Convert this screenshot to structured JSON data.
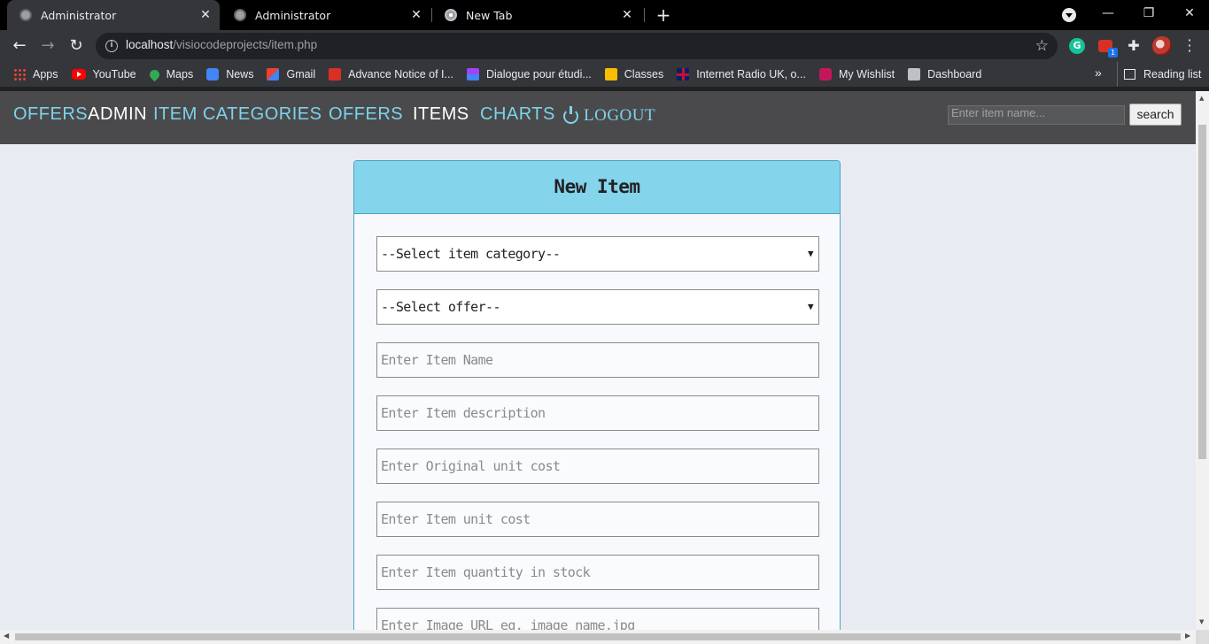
{
  "browser": {
    "tabs": [
      {
        "label": "Administrator",
        "active": true
      },
      {
        "label": "Administrator",
        "active": false
      },
      {
        "label": "New Tab",
        "active": false
      }
    ],
    "url_host": "localhost",
    "url_path": "/visiocodeprojects/item.php",
    "extension_badge": "1",
    "bookmarks": [
      {
        "label": "Apps",
        "icon": "apps-grid-icon"
      },
      {
        "label": "YouTube",
        "icon": "youtube-icon"
      },
      {
        "label": "Maps",
        "icon": "maps-pin-icon"
      },
      {
        "label": "News",
        "icon": "news-icon"
      },
      {
        "label": "Gmail",
        "icon": "gmail-icon"
      },
      {
        "label": "Advance Notice of I...",
        "icon": "mail-icon"
      },
      {
        "label": "Dialogue pour étudi...",
        "icon": "grid-icon"
      },
      {
        "label": "Classes",
        "icon": "classes-icon"
      },
      {
        "label": "Internet Radio UK, o...",
        "icon": "uk-flag-icon"
      },
      {
        "label": "My Wishlist",
        "icon": "wishlist-icon"
      },
      {
        "label": "Dashboard",
        "icon": "dashboard-icon"
      }
    ],
    "reading_list": "Reading list"
  },
  "navbar": {
    "brand_part1": "OFFERS",
    "brand_part2": "ADMIN",
    "links": [
      "ITEM CATEGORIES",
      "OFFERS",
      "ITEMS",
      "CHARTS"
    ],
    "logout": "LOGOUT",
    "search_placeholder": "Enter item name...",
    "search_button": "search"
  },
  "form": {
    "title": "New Item",
    "category_select": "--Select item category--",
    "offer_select": "--Select offer--",
    "placeholders": {
      "item_name": "Enter Item Name",
      "description": "Enter Item description",
      "original_cost": "Enter Original unit cost",
      "unit_cost": "Enter Item unit cost",
      "quantity": "Enter Item quantity in stock",
      "image_url": "Enter Image URL eg. image_name.jpg"
    }
  },
  "colors": {
    "accent": "#7dd3ea",
    "nav_bg": "#4a4a4c",
    "card_header": "#84d4ec",
    "page_bg": "#e9ebf3"
  }
}
